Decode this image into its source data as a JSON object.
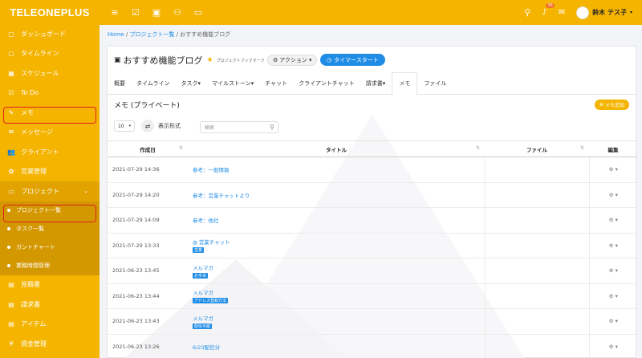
{
  "sidebar": {
    "logo": "TELEONEPLUS",
    "items": [
      {
        "label": "ダッシュボード",
        "icon": "▢"
      },
      {
        "label": "タイムライン",
        "icon": "▢"
      },
      {
        "label": "スケジュール",
        "icon": "▦"
      },
      {
        "label": "To Do",
        "icon": "☑"
      },
      {
        "label": "メモ",
        "icon": "✎"
      },
      {
        "label": "メッセージ",
        "icon": "✉"
      },
      {
        "label": "クライアント",
        "icon": "👥"
      },
      {
        "label": "営業管理",
        "icon": "✿"
      },
      {
        "label": "プロジェクト",
        "icon": "▭"
      }
    ],
    "sub_items": [
      {
        "label": "プロジェクト一覧"
      },
      {
        "label": "タスク一覧"
      },
      {
        "label": "ガントチャート"
      },
      {
        "label": "業務時間管理"
      }
    ],
    "bottom_items": [
      {
        "label": "見積書",
        "icon": "▤"
      },
      {
        "label": "請求書",
        "icon": "▤"
      },
      {
        "label": "アイテム",
        "icon": "▤"
      },
      {
        "label": "資金管理",
        "icon": "¥"
      }
    ]
  },
  "topbar": {
    "notification_count": "36",
    "username": "鈴木 テス子"
  },
  "breadcrumb": {
    "home": "Home",
    "projects": "プロジェクト一覧",
    "current": "おすすめ機能ブログ"
  },
  "project": {
    "title": "おすすめ機能ブログ",
    "bookmark_label": "プロジェクトブックマーク",
    "action_label": "アクション",
    "timer_label": "タイマースタート"
  },
  "tabs": [
    "概要",
    "タイムライン",
    "タスク",
    "マイルストーン",
    "チャット",
    "クライアントチャット",
    "請求書",
    "メモ",
    "ファイル"
  ],
  "memo": {
    "heading": "メモ (プライベート)",
    "add_label": "メモ追加",
    "page_size": "10",
    "view_label": "表示形式",
    "search_placeholder": "検索"
  },
  "table": {
    "columns": [
      "作成日",
      "タイトル",
      "ファイル",
      "編集"
    ],
    "rows": [
      {
        "date": "2021-07-29 14:36",
        "title": "参考：一般情報",
        "tag": ""
      },
      {
        "date": "2021-07-29 14:20",
        "title": "参考：営業チャットより",
        "tag": ""
      },
      {
        "date": "2021-07-29 14:09",
        "title": "参考：他社",
        "tag": ""
      },
      {
        "date": "2021-07-29 13:33",
        "title": "営業チャット",
        "tag": "営業"
      },
      {
        "date": "2021-06-23 13:45",
        "title": "メルマガ",
        "tag": "お手本"
      },
      {
        "date": "2021-06-23 13:44",
        "title": "メルマガ",
        "tag": "アドレス登録方法"
      },
      {
        "date": "2021-06-23 13:43",
        "title": "メルマガ",
        "tag": "配信手順"
      },
      {
        "date": "2021-06-23 13:26",
        "title": "6/23配信分",
        "tag": ""
      }
    ]
  },
  "colors": {
    "accent": "#f4b400",
    "link": "#1f8ce6",
    "highlight": "#e02020"
  }
}
